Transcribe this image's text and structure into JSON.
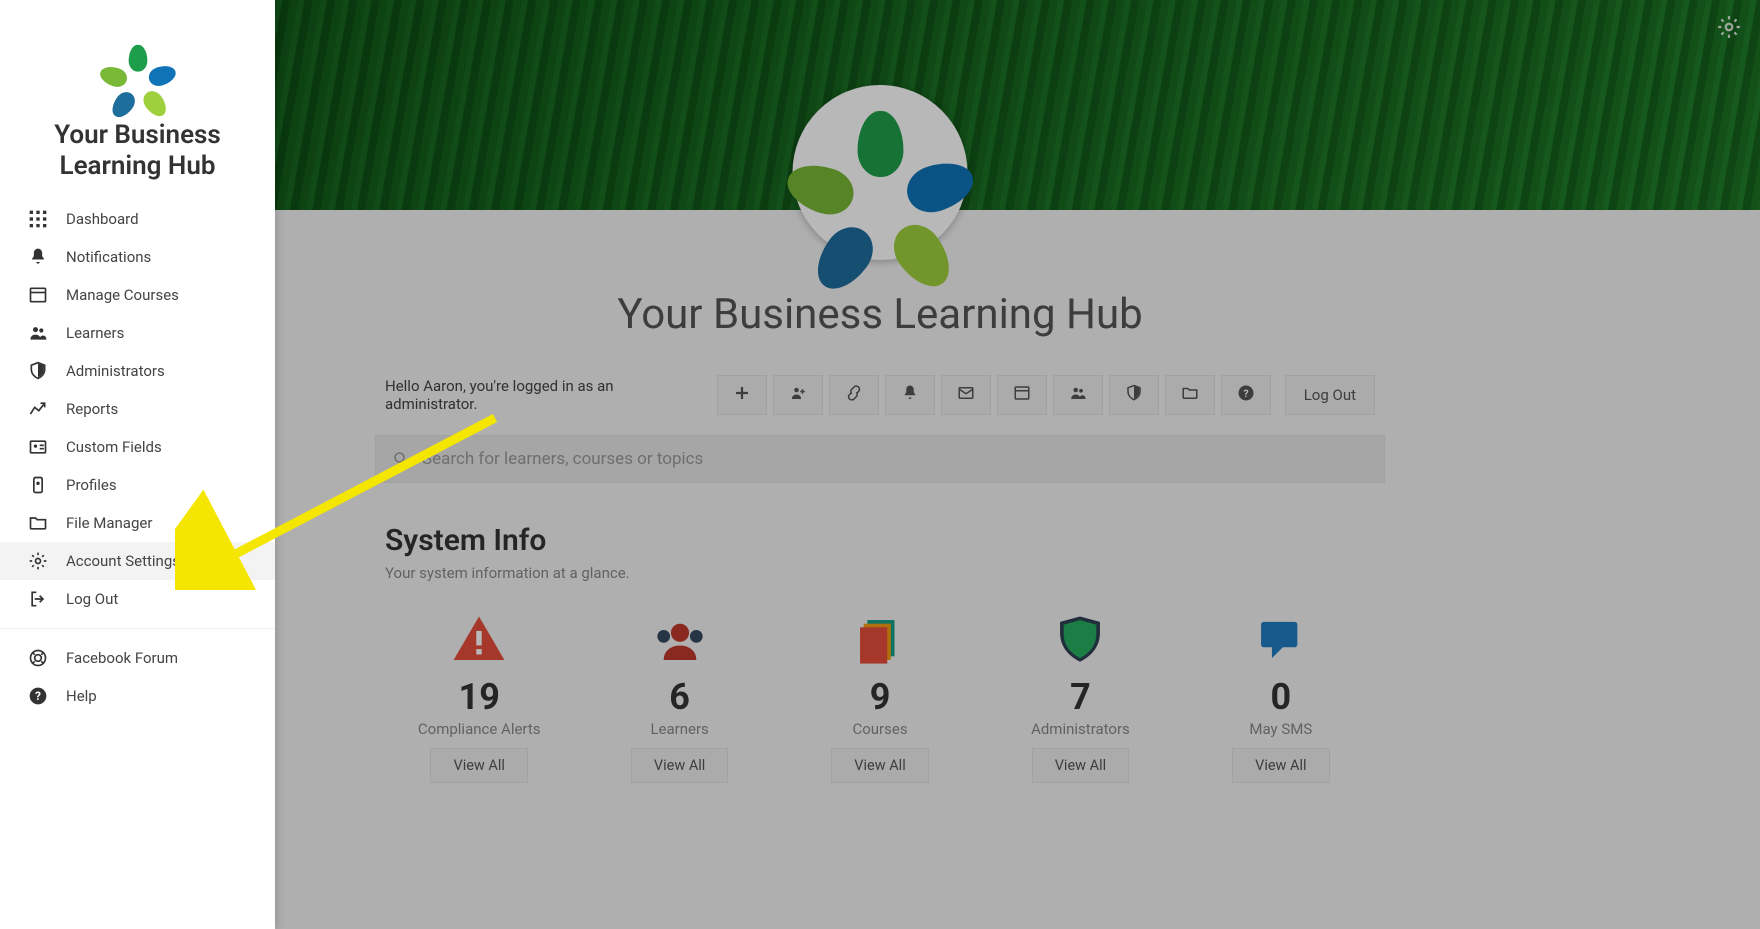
{
  "brand_title": "Your Business Learning Hub",
  "sidebar_items": [
    {
      "id": "dashboard",
      "label": "Dashboard",
      "icon": "grid"
    },
    {
      "id": "notifications",
      "label": "Notifications",
      "icon": "bell"
    },
    {
      "id": "manage-courses",
      "label": "Manage Courses",
      "icon": "window"
    },
    {
      "id": "learners",
      "label": "Learners",
      "icon": "users"
    },
    {
      "id": "administrators",
      "label": "Administrators",
      "icon": "shield"
    },
    {
      "id": "reports",
      "label": "Reports",
      "icon": "chart"
    },
    {
      "id": "custom-fields",
      "label": "Custom Fields",
      "icon": "idcard"
    },
    {
      "id": "profiles",
      "label": "Profiles",
      "icon": "badge"
    },
    {
      "id": "file-manager",
      "label": "File Manager",
      "icon": "folder"
    },
    {
      "id": "account-settings",
      "label": "Account Settings",
      "icon": "gear",
      "active": true
    },
    {
      "id": "log-out",
      "label": "Log Out",
      "icon": "exit"
    }
  ],
  "sidebar_footer": [
    {
      "id": "facebook-forum",
      "label": "Facebook Forum",
      "icon": "lifering"
    },
    {
      "id": "help",
      "label": "Help",
      "icon": "question"
    }
  ],
  "welcome_text": "Hello Aaron, you're logged in as an administrator.",
  "toolbar_buttons": [
    {
      "id": "add",
      "icon": "plus"
    },
    {
      "id": "add-user",
      "icon": "userplus"
    },
    {
      "id": "link",
      "icon": "link"
    },
    {
      "id": "alerts",
      "icon": "bell"
    },
    {
      "id": "mail",
      "icon": "envelope"
    },
    {
      "id": "calendar",
      "icon": "window"
    },
    {
      "id": "learners",
      "icon": "users"
    },
    {
      "id": "admins",
      "icon": "shield"
    },
    {
      "id": "files",
      "icon": "folder"
    },
    {
      "id": "help",
      "icon": "question"
    }
  ],
  "logout_button": "Log Out",
  "hub_title": "Your Business Learning Hub",
  "search_placeholder": "Search for learners, courses or topics",
  "system_info": {
    "heading": "System Info",
    "sub": "Your system information at a glance.",
    "stats": [
      {
        "value": "19",
        "label": "Compliance Alerts",
        "icon": "alert",
        "cta": "View All"
      },
      {
        "value": "6",
        "label": "Learners",
        "icon": "learners",
        "cta": "View All"
      },
      {
        "value": "9",
        "label": "Courses",
        "icon": "courses",
        "cta": "View All"
      },
      {
        "value": "7",
        "label": "Administrators",
        "icon": "shield2",
        "cta": "View All"
      },
      {
        "value": "0",
        "label": "May SMS",
        "icon": "chat",
        "cta": "View All"
      }
    ]
  }
}
